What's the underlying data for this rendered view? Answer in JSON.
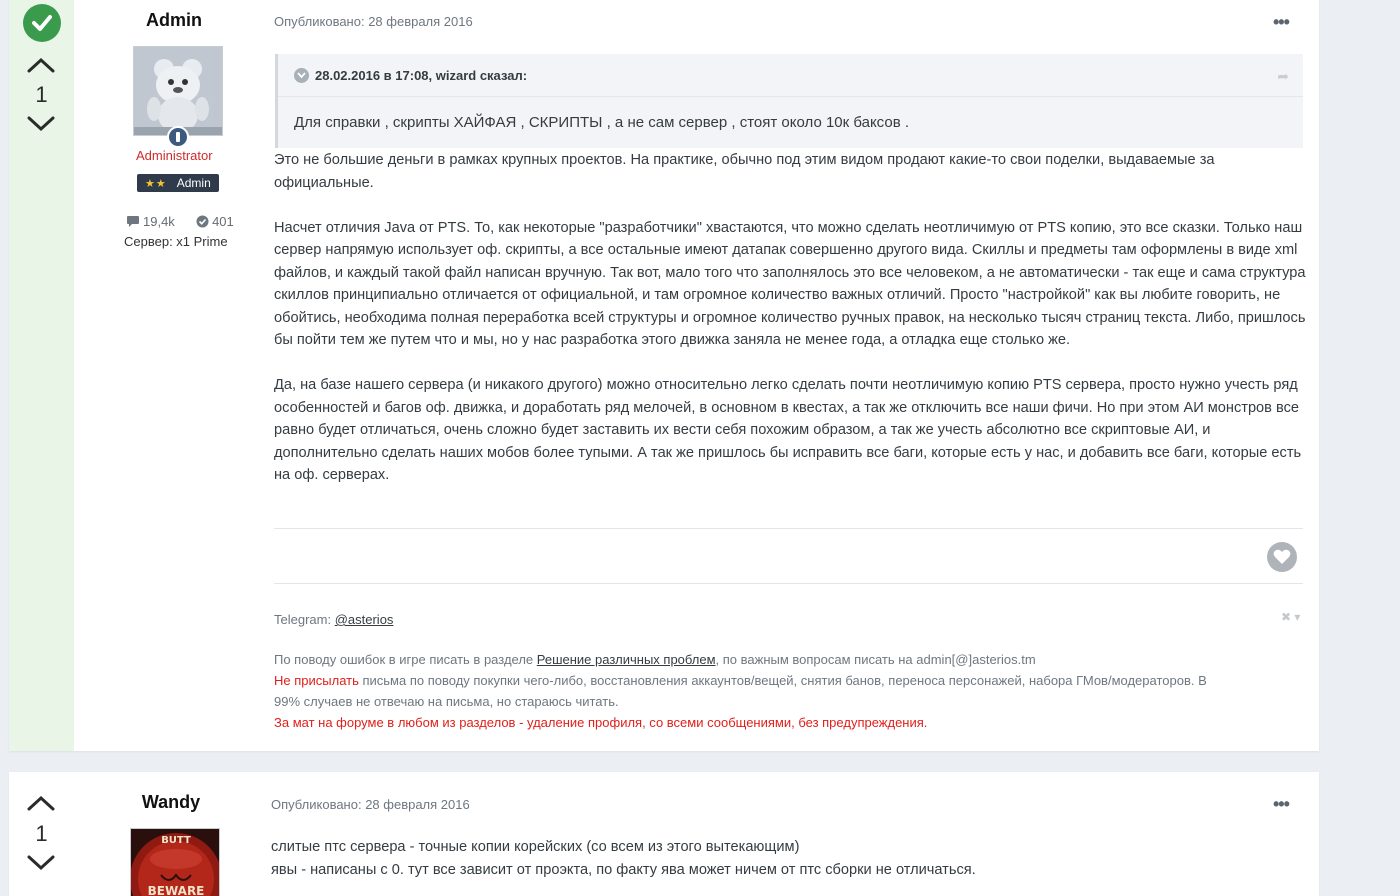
{
  "colors": {
    "accent_green": "#3a9b4c",
    "vote_col_bg": "#e9f6e7",
    "role_red": "#d12a2a",
    "warning_red": "#e0201b"
  },
  "post1": {
    "author": "Admin",
    "role": "Administrator",
    "rank_stars": "★★",
    "rank_label": "Admin",
    "stats_posts": "19,4k",
    "stats_rep": "401",
    "server": "Сервер: x1 Prime",
    "vote_count": "1",
    "date": "Опубликовано: 28 февраля 2016",
    "more": "•••",
    "quote": {
      "header": "28.02.2016 в 17:08, wizard сказал:",
      "text": "Для справки , скрипты ХАЙФАЯ , СКРИПТЫ , а не сам сервер , стоят около 10к баксов ."
    },
    "paragraphs": [
      "Это не большие деньги в рамках крупных проектов. На практике, обычно под этим видом продают какие-то свои поделки, выдаваемые за официальные.",
      "Насчет отличия Java от PTS. То, как некоторые \"разработчики\" хвастаются, что можно сделать неотличимую от PTS копию, это все сказки. Только наш сервер напрямую использует оф. скрипты, а все остальные имеют датапак совершенно другого вида. Скиллы и предметы там оформлены в виде xml файлов, и каждый такой файл написан вручную. Так вот, мало того что заполнялось это все человеком, а не автоматически - так еще и сама структура скиллов принципиально отличается от официальной, и там огромное количество важных отличий. Просто \"настройкой\" как вы любите говорить, не обойтись, необходима полная переработка всей структуры и огромное количество ручных правок, на несколько тысяч страниц текста. Либо, пришлось бы пойти тем же путем что и мы, но у нас разработка этого движка заняла не менее года, а отладка еще столько же.",
      "Да, на базе нашего сервера (и никакого другого) можно относительно легко сделать почти неотличимую копию PTS сервера, просто нужно учесть ряд особенностей и багов оф. движка, и доработать ряд мелочей, в основном в квестах, а так же отключить все наши фичи. Но при этом АИ монстров все равно будет отличаться, очень сложно будет заставить их вести себя похожим образом, а так же учесть абсолютно все скриптовые АИ, и дополнительно сделать наших мобов более тупыми. А так же пришлось бы исправить все баги, которые есть у нас, и добавить все баги, которые есть на оф. серверах."
    ],
    "signature": {
      "telegram_label": "Telegram: ",
      "telegram_link": "@asterios",
      "close": "✖ ▾",
      "line1_pre": "По поводу ошибок в игре писать в разделе ",
      "line1_link": "Решение различных проблем",
      "line1_post": ", по важным вопросам писать на admin[@]asterios.tm",
      "line2_red": "Не присылать",
      "line2_rest": " письма по поводу покупки чего-либо, восстановления аккаунтов/вещей, снятия банов, переноса персонажей, набора ГМов/модераторов. В",
      "line3": "99% случаев не отвечаю на письма, но стараюсь читать.",
      "line4": "За мат на форуме в любом из разделов - удаление профиля, со всеми сообщениями, без предупреждения."
    }
  },
  "post2": {
    "author": "Wandy",
    "vote_count": "1",
    "date": "Опубликовано: 28 февраля 2016",
    "more": "•••",
    "avatar_text_top": "BUTT",
    "avatar_text_bottom": "BEWARE",
    "lines": [
      "слитые птс сервера - точные копии корейских (со всем из этого вытекающим)",
      "явы - написаны с 0.  тут все зависит от проэкта, по факту ява может ничем от птс сборки не отличаться."
    ]
  }
}
